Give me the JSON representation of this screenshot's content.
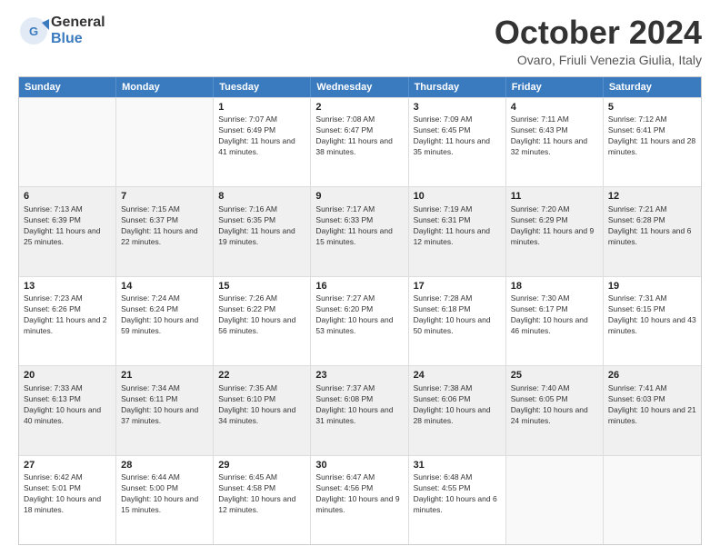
{
  "header": {
    "logo_general": "General",
    "logo_blue": "Blue",
    "month_title": "October 2024",
    "location": "Ovaro, Friuli Venezia Giulia, Italy"
  },
  "weekdays": [
    "Sunday",
    "Monday",
    "Tuesday",
    "Wednesday",
    "Thursday",
    "Friday",
    "Saturday"
  ],
  "weeks": [
    [
      {
        "day": "",
        "empty": true
      },
      {
        "day": "",
        "empty": true
      },
      {
        "day": "1",
        "sunrise": "7:07 AM",
        "sunset": "6:49 PM",
        "daylight": "11 hours and 41 minutes."
      },
      {
        "day": "2",
        "sunrise": "7:08 AM",
        "sunset": "6:47 PM",
        "daylight": "11 hours and 38 minutes."
      },
      {
        "day": "3",
        "sunrise": "7:09 AM",
        "sunset": "6:45 PM",
        "daylight": "11 hours and 35 minutes."
      },
      {
        "day": "4",
        "sunrise": "7:11 AM",
        "sunset": "6:43 PM",
        "daylight": "11 hours and 32 minutes."
      },
      {
        "day": "5",
        "sunrise": "7:12 AM",
        "sunset": "6:41 PM",
        "daylight": "11 hours and 28 minutes."
      }
    ],
    [
      {
        "day": "6",
        "sunrise": "7:13 AM",
        "sunset": "6:39 PM",
        "daylight": "11 hours and 25 minutes."
      },
      {
        "day": "7",
        "sunrise": "7:15 AM",
        "sunset": "6:37 PM",
        "daylight": "11 hours and 22 minutes."
      },
      {
        "day": "8",
        "sunrise": "7:16 AM",
        "sunset": "6:35 PM",
        "daylight": "11 hours and 19 minutes."
      },
      {
        "day": "9",
        "sunrise": "7:17 AM",
        "sunset": "6:33 PM",
        "daylight": "11 hours and 15 minutes."
      },
      {
        "day": "10",
        "sunrise": "7:19 AM",
        "sunset": "6:31 PM",
        "daylight": "11 hours and 12 minutes."
      },
      {
        "day": "11",
        "sunrise": "7:20 AM",
        "sunset": "6:29 PM",
        "daylight": "11 hours and 9 minutes."
      },
      {
        "day": "12",
        "sunrise": "7:21 AM",
        "sunset": "6:28 PM",
        "daylight": "11 hours and 6 minutes."
      }
    ],
    [
      {
        "day": "13",
        "sunrise": "7:23 AM",
        "sunset": "6:26 PM",
        "daylight": "11 hours and 2 minutes."
      },
      {
        "day": "14",
        "sunrise": "7:24 AM",
        "sunset": "6:24 PM",
        "daylight": "10 hours and 59 minutes."
      },
      {
        "day": "15",
        "sunrise": "7:26 AM",
        "sunset": "6:22 PM",
        "daylight": "10 hours and 56 minutes."
      },
      {
        "day": "16",
        "sunrise": "7:27 AM",
        "sunset": "6:20 PM",
        "daylight": "10 hours and 53 minutes."
      },
      {
        "day": "17",
        "sunrise": "7:28 AM",
        "sunset": "6:18 PM",
        "daylight": "10 hours and 50 minutes."
      },
      {
        "day": "18",
        "sunrise": "7:30 AM",
        "sunset": "6:17 PM",
        "daylight": "10 hours and 46 minutes."
      },
      {
        "day": "19",
        "sunrise": "7:31 AM",
        "sunset": "6:15 PM",
        "daylight": "10 hours and 43 minutes."
      }
    ],
    [
      {
        "day": "20",
        "sunrise": "7:33 AM",
        "sunset": "6:13 PM",
        "daylight": "10 hours and 40 minutes."
      },
      {
        "day": "21",
        "sunrise": "7:34 AM",
        "sunset": "6:11 PM",
        "daylight": "10 hours and 37 minutes."
      },
      {
        "day": "22",
        "sunrise": "7:35 AM",
        "sunset": "6:10 PM",
        "daylight": "10 hours and 34 minutes."
      },
      {
        "day": "23",
        "sunrise": "7:37 AM",
        "sunset": "6:08 PM",
        "daylight": "10 hours and 31 minutes."
      },
      {
        "day": "24",
        "sunrise": "7:38 AM",
        "sunset": "6:06 PM",
        "daylight": "10 hours and 28 minutes."
      },
      {
        "day": "25",
        "sunrise": "7:40 AM",
        "sunset": "6:05 PM",
        "daylight": "10 hours and 24 minutes."
      },
      {
        "day": "26",
        "sunrise": "7:41 AM",
        "sunset": "6:03 PM",
        "daylight": "10 hours and 21 minutes."
      }
    ],
    [
      {
        "day": "27",
        "sunrise": "6:42 AM",
        "sunset": "5:01 PM",
        "daylight": "10 hours and 18 minutes."
      },
      {
        "day": "28",
        "sunrise": "6:44 AM",
        "sunset": "5:00 PM",
        "daylight": "10 hours and 15 minutes."
      },
      {
        "day": "29",
        "sunrise": "6:45 AM",
        "sunset": "4:58 PM",
        "daylight": "10 hours and 12 minutes."
      },
      {
        "day": "30",
        "sunrise": "6:47 AM",
        "sunset": "4:56 PM",
        "daylight": "10 hours and 9 minutes."
      },
      {
        "day": "31",
        "sunrise": "6:48 AM",
        "sunset": "4:55 PM",
        "daylight": "10 hours and 6 minutes."
      },
      {
        "day": "",
        "empty": true
      },
      {
        "day": "",
        "empty": true
      }
    ]
  ],
  "labels": {
    "sunrise": "Sunrise:",
    "sunset": "Sunset:",
    "daylight": "Daylight:"
  }
}
